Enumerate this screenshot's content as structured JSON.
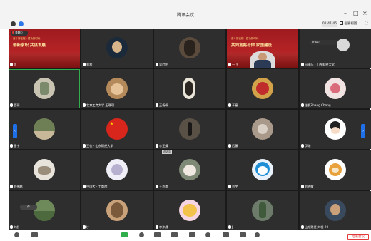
{
  "window": {
    "title": "腾讯会议",
    "minimize": "–",
    "maximize": "□",
    "close": "×"
  },
  "subbar": {
    "timer": "01:41:45",
    "view_mode": "画廊视图",
    "view_mode_caret": "⌄",
    "fullscreen": "⛶"
  },
  "banner_tile_1": {
    "line1": "奋斗新征程 · 建功新时代",
    "line2": "创新求职 共谋发展"
  },
  "banner_tile_4": {
    "line1": "奋斗新征程 · 建功新时代",
    "line2": "共同富裕与你 家国建设"
  },
  "chip": {
    "recording": "录制中",
    "speaking": "说话中",
    "self": "你"
  },
  "participants": [
    "你",
    "刘程",
    "吴红明",
    "一飞",
    "马國乐 - 山东财经大学",
    "管琛",
    "北京工商大学 王璟璟",
    "王杨帆",
    "于童",
    "张帆Zhang Chang",
    "雷宇",
    "王佳 - 山东财经大学",
    "李王婧",
    "后藤",
    "伊朗",
    "刘伟鹏",
    "中国大 - 工商院",
    "王亦南",
    "刘宇",
    "刘秀敏",
    "刘舒",
    "ly",
    "李沐晨",
    "J",
    "山东财经 刘程 20"
  ],
  "nav": {
    "left_arrow": "‹",
    "right_arrow": "›"
  },
  "toolbar": {
    "leave_label": "结束会议"
  },
  "colors": {
    "tile_bg": "#2e2e2e",
    "grid_bg": "#1a1a1a",
    "active_border": "#2fae4b",
    "nav_arrow": "#1f6fe8",
    "leave_red": "#e23a3a",
    "banner_red": "#b32b2b"
  }
}
